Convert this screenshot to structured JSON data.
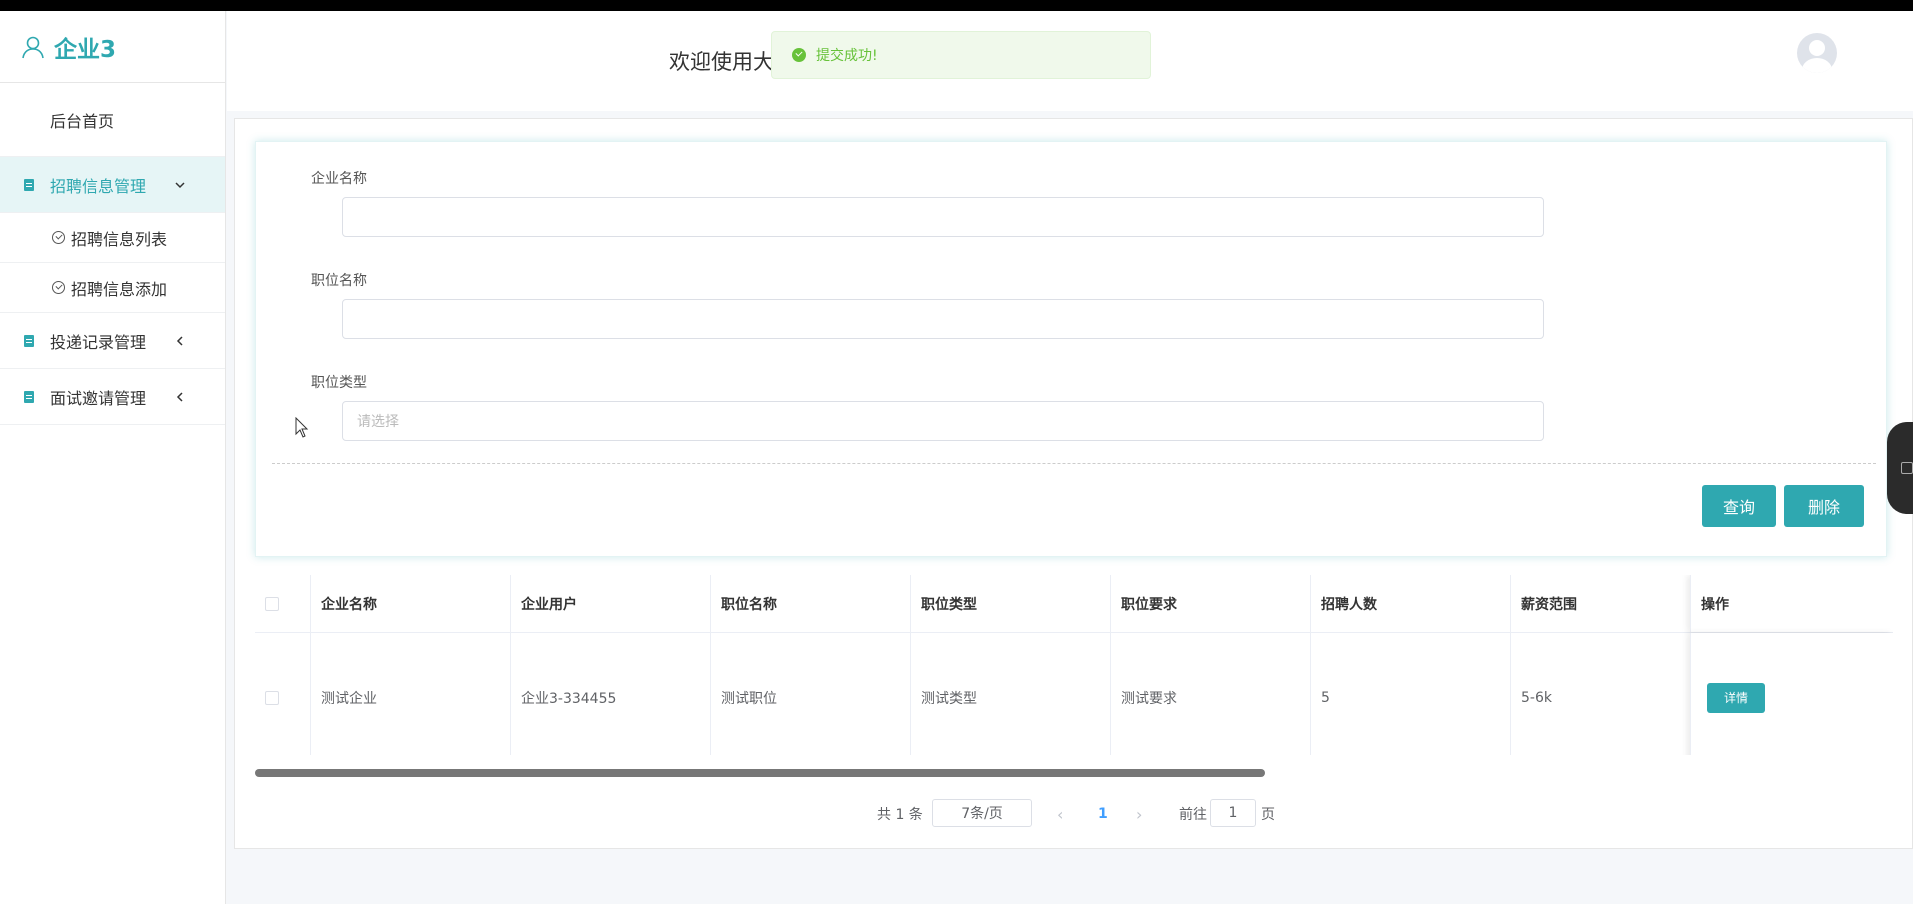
{
  "brand": {
    "name": "企业3"
  },
  "sidebar": {
    "home": "后台首页",
    "groups": [
      {
        "label": "招聘信息管理",
        "sub": [
          "招聘信息列表",
          "招聘信息添加"
        ]
      },
      {
        "label": "投递记录管理"
      },
      {
        "label": "面试邀请管理"
      }
    ]
  },
  "header": {
    "welcome": "欢迎使用大"
  },
  "toast": {
    "message": "提交成功!"
  },
  "form": {
    "company_label": "企业名称",
    "position_label": "职位名称",
    "type_label": "职位类型",
    "type_placeholder": "请选择",
    "query_label": "查询",
    "delete_label": "删除"
  },
  "table": {
    "columns": [
      "企业名称",
      "企业用户",
      "职位名称",
      "职位类型",
      "职位要求",
      "招聘人数",
      "薪资范围",
      "操作"
    ],
    "rows": [
      [
        "测试企业",
        "企业3-334455",
        "测试职位",
        "测试类型",
        "测试要求",
        "5",
        "5-6k"
      ]
    ],
    "detail_label": "详情"
  },
  "pagination": {
    "total": "共 1 条",
    "page_size": "7条/页",
    "current": "1",
    "goto_prefix": "前往",
    "goto_value": "1",
    "goto_suffix": "页"
  },
  "colors": {
    "accent": "#2fa8b0",
    "success": "#67c23a"
  }
}
